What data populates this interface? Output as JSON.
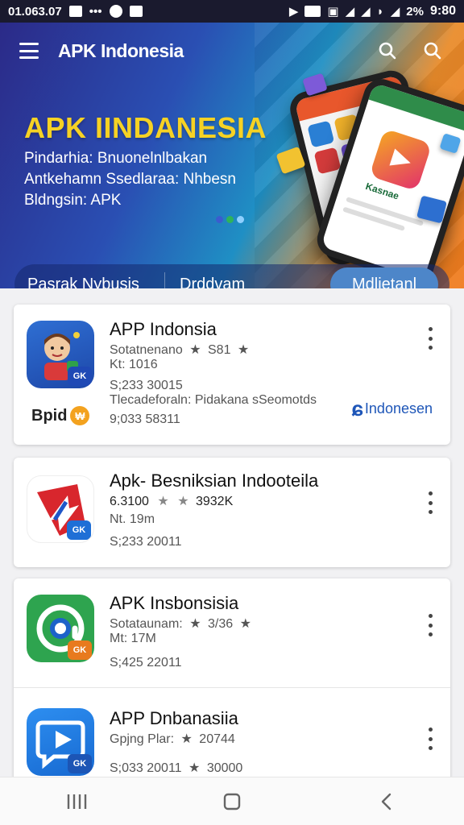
{
  "status_bar": {
    "time_left": "01.063.07",
    "battery_text": "2%",
    "clock": "9:80"
  },
  "header": {
    "title": "APK Indonesia",
    "menu_icon": "hamburger-menu-icon",
    "actions": [
      "search-icon",
      "search-icon"
    ]
  },
  "hero": {
    "heading": "APK IINDANESIA",
    "lines": [
      "Pindarhia: Bnuonelnlbakan",
      "Antkehamn Ssedlaraa: Nhbesn",
      "Bldngsin: APK"
    ],
    "phone_label": "Kasnae",
    "colors": {
      "heading": "#f6d224",
      "accent": "#f07b1e"
    }
  },
  "tabs": {
    "items": [
      "Pasrak Nybusis",
      "Drddvam"
    ],
    "active": "Mdlietanl"
  },
  "apps": [
    {
      "name": "APP Indonsia",
      "line1": "Sotatnenano",
      "line1_value": "S81",
      "line2": "Kt: 1016",
      "line3": "S;233 30015",
      "line4": "Tlecadeforaln: Pidakana sSeomotds",
      "line5": "9;033 58311",
      "footer_logo": "Bpid",
      "footer_badge": "Indonesen",
      "badge": "GK",
      "icon": "avatar-character-icon"
    },
    {
      "name": "Apk- Besniksian Indooteila",
      "line1": "6.3100",
      "line1_value": "3932K",
      "line2": "Nt. 19m",
      "line3": "S;233 20011",
      "badge": "GK",
      "icon": "arrow-up-icon"
    },
    {
      "name": "APK Insbonsisia",
      "line1": "Sotataunam:",
      "line1_value": "3/36",
      "line2": "Mt: 17M",
      "line3": "S;425 22011",
      "badge": "GK",
      "icon": "at-sign-icon"
    },
    {
      "name": "APP Dnbanasiia",
      "line1": "Gpjng Plar:",
      "line1_value": "20744",
      "line3": "S;033 20011",
      "line3_value": "30000",
      "badge": "GK",
      "icon": "play-chat-icon"
    }
  ],
  "nav": [
    "recents-icon",
    "home-icon",
    "back-icon"
  ]
}
